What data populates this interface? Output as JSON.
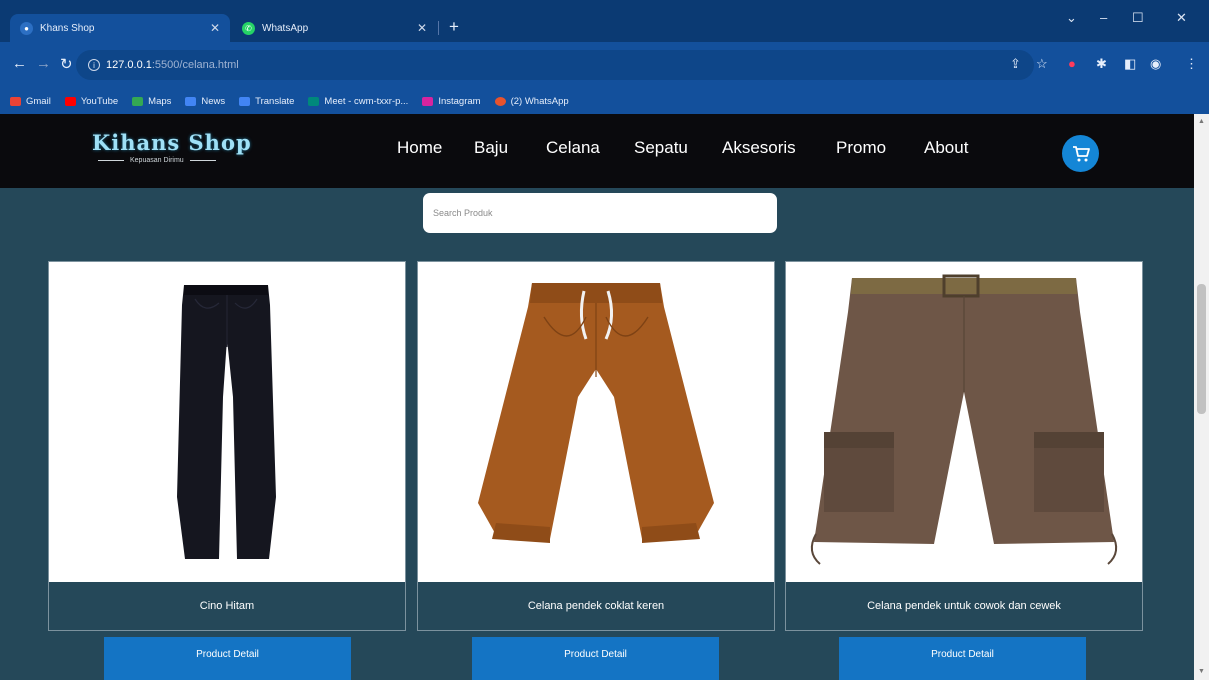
{
  "browser": {
    "tabs": [
      {
        "title": "Khans Shop",
        "active": true
      },
      {
        "title": "WhatsApp",
        "active": false
      }
    ],
    "address": {
      "host": "127.0.0.1",
      "path": ":5500/celana.html"
    },
    "bookmarks": [
      {
        "label": "Gmail",
        "color": "#ea4335"
      },
      {
        "label": "YouTube",
        "color": "#ff0000"
      },
      {
        "label": "Maps",
        "color": "#34a853"
      },
      {
        "label": "News",
        "color": "#4285f4"
      },
      {
        "label": "Translate",
        "color": "#4285f4"
      },
      {
        "label": "Meet - cwm-txxr-p...",
        "color": "#00897b"
      },
      {
        "label": "Instagram",
        "color": "#d6249f"
      },
      {
        "label": "(2) WhatsApp",
        "color": "#25d366"
      }
    ]
  },
  "site": {
    "logo": {
      "name": "Kihans Shop",
      "tagline": "Kepuasan Dirimu"
    },
    "menu": [
      "Home",
      "Baju",
      "Celana",
      "Sepatu",
      "Aksesoris",
      "Promo",
      "About"
    ],
    "search_placeholder": "Search Produk",
    "products": [
      {
        "name": "Cino Hitam",
        "button": "Product Detail"
      },
      {
        "name": "Celana pendek coklat keren",
        "button": "Product Detail"
      },
      {
        "name": "Celana pendek untuk cowok dan cewek",
        "button": "Product Detail"
      }
    ]
  },
  "colors": {
    "nav_bg": "#0a0a0d",
    "page_bg": "#254859",
    "accent": "#1474c4",
    "cart": "#1486d6"
  }
}
